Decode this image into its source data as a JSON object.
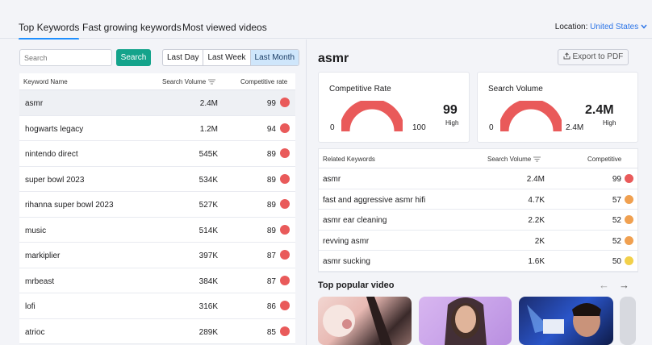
{
  "tabs": [
    "Top Keywords",
    "Fast growing keywords",
    "Most viewed videos"
  ],
  "location": {
    "label": "Location:",
    "value": "United States"
  },
  "search": {
    "placeholder": "Search",
    "button": "Search"
  },
  "periods": [
    "Last Day",
    "Last Week",
    "Last Month"
  ],
  "keywords_table": {
    "headers": {
      "name": "Keyword Name",
      "volume": "Search Volume",
      "rate": "Competitive rate"
    },
    "rows": [
      {
        "name": "asmr",
        "volume": "2.4M",
        "rate": "99",
        "color": "#e95a5a"
      },
      {
        "name": "hogwarts legacy",
        "volume": "1.2M",
        "rate": "94",
        "color": "#e95a5a"
      },
      {
        "name": "nintendo direct",
        "volume": "545K",
        "rate": "89",
        "color": "#e95a5a"
      },
      {
        "name": "super bowl 2023",
        "volume": "534K",
        "rate": "89",
        "color": "#e95a5a"
      },
      {
        "name": "rihanna super bowl 2023",
        "volume": "527K",
        "rate": "89",
        "color": "#e95a5a"
      },
      {
        "name": "music",
        "volume": "514K",
        "rate": "89",
        "color": "#e95a5a"
      },
      {
        "name": "markiplier",
        "volume": "397K",
        "rate": "87",
        "color": "#e95a5a"
      },
      {
        "name": "mrbeast",
        "volume": "384K",
        "rate": "87",
        "color": "#e95a5a"
      },
      {
        "name": "lofi",
        "volume": "316K",
        "rate": "86",
        "color": "#e95a5a"
      },
      {
        "name": "atrioc",
        "volume": "289K",
        "rate": "85",
        "color": "#e95a5a"
      }
    ]
  },
  "detail": {
    "keyword": "asmr",
    "export": "Export to PDF",
    "competitive": {
      "title": "Competitive Rate",
      "min": "0",
      "max": "100",
      "value": "99",
      "level": "High"
    },
    "volume": {
      "title": "Search Volume",
      "min": "0",
      "max": "2.4M",
      "value": "2.4M",
      "level": "High"
    }
  },
  "related_table": {
    "headers": {
      "name": "Related Keywords",
      "volume": "Search Volume",
      "comp": "Competitive"
    },
    "rows": [
      {
        "name": "asmr",
        "volume": "2.4M",
        "comp": "99",
        "color": "#e95a5a"
      },
      {
        "name": "fast and aggressive asmr hifi",
        "volume": "4.7K",
        "comp": "57",
        "color": "#f0a050"
      },
      {
        "name": "asmr ear cleaning",
        "volume": "2.2K",
        "comp": "52",
        "color": "#f0a050"
      },
      {
        "name": "revving asmr",
        "volume": "2K",
        "comp": "52",
        "color": "#f0a050"
      },
      {
        "name": "asmr sucking",
        "volume": "1.6K",
        "comp": "50",
        "color": "#f2d04a"
      }
    ]
  },
  "popular": {
    "title": "Top popular video",
    "prev": "←",
    "next": "→"
  },
  "colors": {
    "accent": "#1f8fff",
    "primary_button": "#14a38b",
    "gauge": "#e95a5a"
  }
}
